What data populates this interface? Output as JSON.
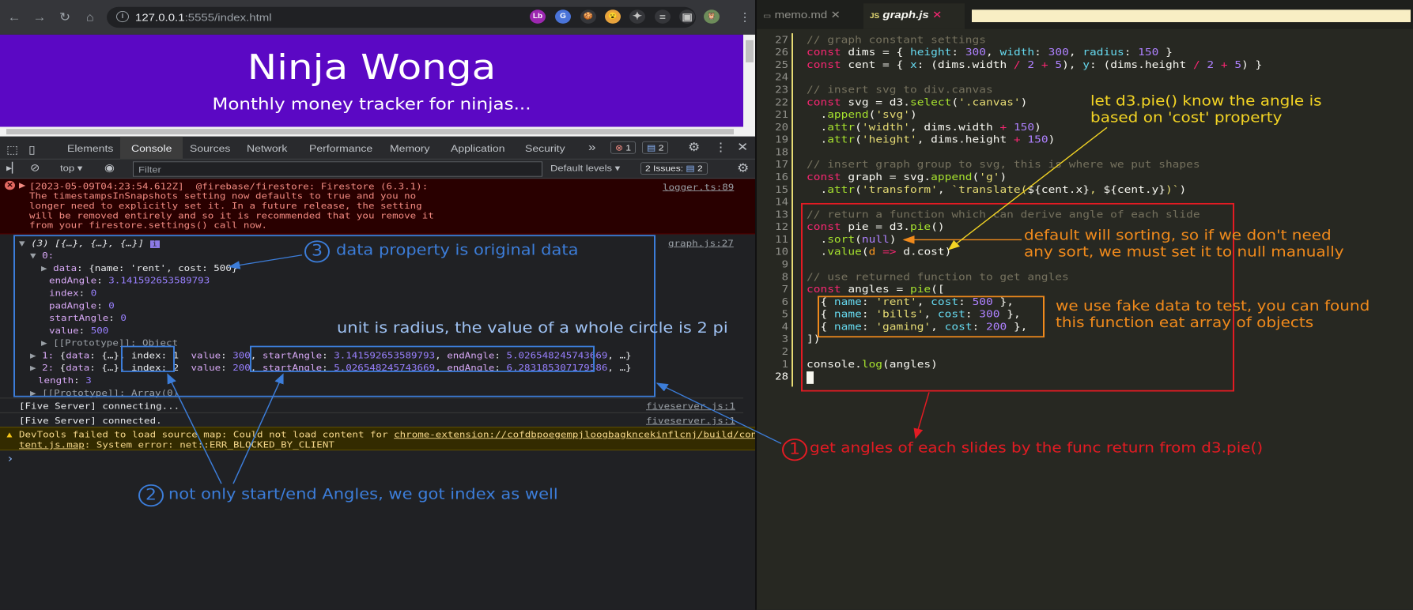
{
  "browser": {
    "url_host": "127.0.0.1",
    "url_rest": ":5555/index.html",
    "ext_labels": [
      "Lb",
      "G",
      "🍪",
      "😮",
      "✦",
      "≡",
      "▣",
      "🦉"
    ]
  },
  "page": {
    "title": "Ninja Wonga",
    "subtitle": "Monthly money tracker for ninjas..."
  },
  "devtools": {
    "tabs": [
      "Elements",
      "Console",
      "Sources",
      "Network",
      "Performance",
      "Memory",
      "Application",
      "Security"
    ],
    "more": "»",
    "errors": "1",
    "messages": "2",
    "context": "top",
    "filter_placeholder": "Filter",
    "levels": "Default levels",
    "issues": "2 Issues: ",
    "issues_count": "2"
  },
  "console": {
    "error_text": "[2023-05-09T04:23:54.612Z]  @firebase/firestore: Firestore (6.3.1):\nThe timestampsInSnapshots setting now defaults to true and you no\nlonger need to explicitly set it. In a future release, the setting\nwill be removed entirely and so it is recommended that you remove it\nfrom your firestore.settings() call now.",
    "error_src": "logger.ts:89",
    "log_src": "graph.js:27",
    "arr_head": "(3) [{…}, {…}, {…}]",
    "item0": "0:",
    "data_line": "{name: 'rent', cost: 500}",
    "end_angle": "3.141592653589793",
    "index0": "0",
    "pad": "0",
    "start0": "0",
    "value0": "500",
    "proto_obj": "[[Prototype]]: Object",
    "row1": {
      "idx": "1",
      "index": "index: 1",
      "value": "300",
      "start": "3.141592653589793",
      "end": "5.026548245743669"
    },
    "row2": {
      "idx": "2",
      "index": "index: 2",
      "value": "200",
      "start": "5.026548245743669",
      "end": "6.283185307179586"
    },
    "length": "3",
    "proto_arr": "[[Prototype]]: Array(0)",
    "fs1": "[Five Server] connecting...",
    "fs2": "[Five Server] connected.",
    "fs_src": "fiveserver.js:1",
    "warn_a": "DevTools failed to load source map: Could not load content for ",
    "warn_link": "chrome-extension://cofdbpoegempjloogbagkncekinflcnj/build/con",
    "warn_b": "tent.js.map",
    "warn_c": ": System error: net::ERR_BLOCKED_BY_CLIENT",
    "prompt": "›"
  },
  "annotations": {
    "a1": "get angles of each slides by the func return from d3.pie()",
    "a2": "not only start/end Angles, we got index as well",
    "a3": "data property is original data",
    "unit": "unit is radius, the value of a whole circle is 2 pi",
    "pie1": "let d3.pie() know the angle is",
    "pie2": "based on 'cost' property",
    "sort1": "default will sorting, so if we don't need",
    "sort2": "any sort, we must set it to null manually",
    "fake1": "we use fake data to test, you can found",
    "fake2": "this function eat array of objects",
    "n1": "1",
    "n2": "2",
    "n3": "3"
  },
  "editor": {
    "tab1": "memo.md",
    "tab2": "graph.js",
    "line_numbers": [
      "27",
      "26",
      "25",
      "24",
      "23",
      "22",
      "21",
      "20",
      "19",
      "18",
      "17",
      "16",
      "15",
      "14",
      "13",
      "12",
      "11",
      "10",
      "9",
      "8",
      "7",
      "6",
      "5",
      "4",
      "3",
      "2",
      "1",
      "28"
    ]
  },
  "colors": {
    "accent_red": "#e31b23",
    "accent_blue": "#3c7dd9",
    "accent_orange": "#f08a1c",
    "accent_yellow": "#f3d424"
  }
}
